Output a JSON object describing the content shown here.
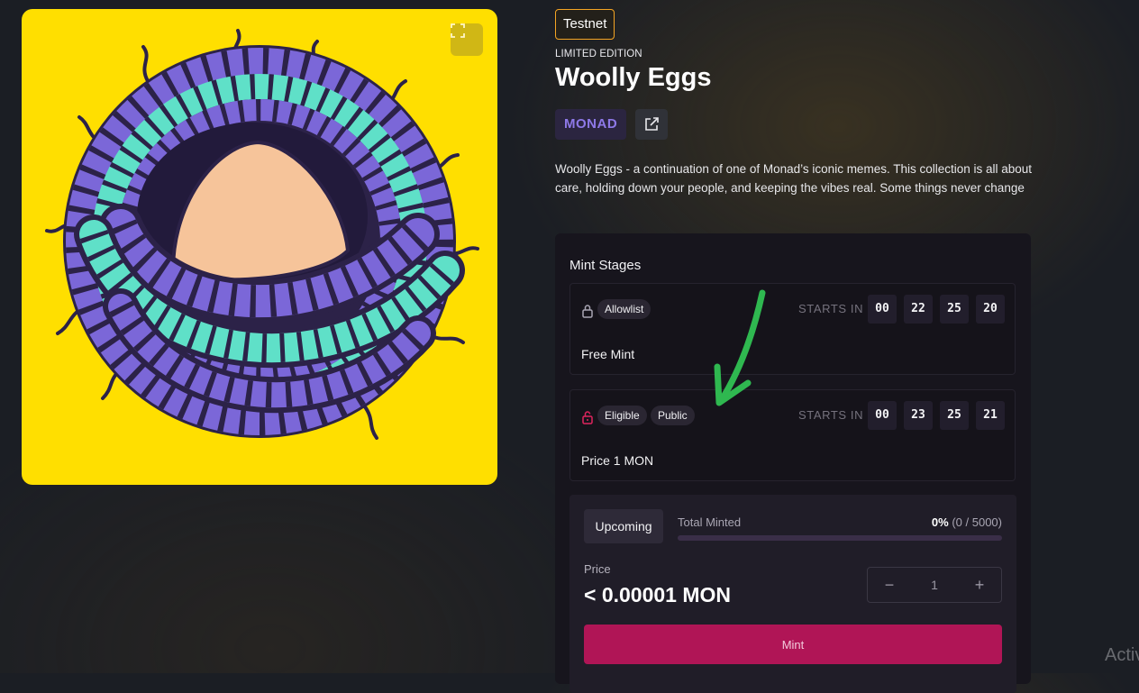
{
  "header": {
    "network_badge": "Testnet",
    "edition_label": "LIMITED EDITION",
    "title": "Woolly Eggs",
    "chain": "MONAD",
    "description": "Woolly Eggs - a continuation of one of Monad’s iconic memes. This collection is all about care, holding down your people, and keeping the vibes real. Some things never change"
  },
  "colors": {
    "art_background": "#ffdf00",
    "accent_mint": "#b01556",
    "chain_chip_text": "#8e79e8",
    "testnet_border": "#f5a524"
  },
  "icons": {
    "expand": "expand-icon",
    "external_link": "external-link-icon",
    "lock": "lock-icon"
  },
  "mint_stages": {
    "title": "Mint Stages",
    "stages": [
      {
        "tags": [
          "Allowlist"
        ],
        "starts_label": "STARTS IN",
        "countdown": [
          "00",
          "22",
          "25",
          "20"
        ],
        "footer": "Free Mint",
        "lock_color": "#a9a6b3"
      },
      {
        "tags": [
          "Eligible",
          "Public"
        ],
        "starts_label": "STARTS IN",
        "countdown": [
          "00",
          "23",
          "25",
          "21"
        ],
        "footer": "Price  1 MON",
        "lock_color": "#e0245e"
      }
    ]
  },
  "mint": {
    "status": "Upcoming",
    "total_minted_label": "Total Minted",
    "percent": "0%",
    "count": "(0 / 5000)",
    "progress_fraction": 0,
    "price_label": "Price",
    "price_value": "< 0.00001 MON",
    "quantity": "1",
    "minus": "−",
    "plus": "+",
    "button_label": "Mint"
  },
  "os_watermark": "Activ"
}
